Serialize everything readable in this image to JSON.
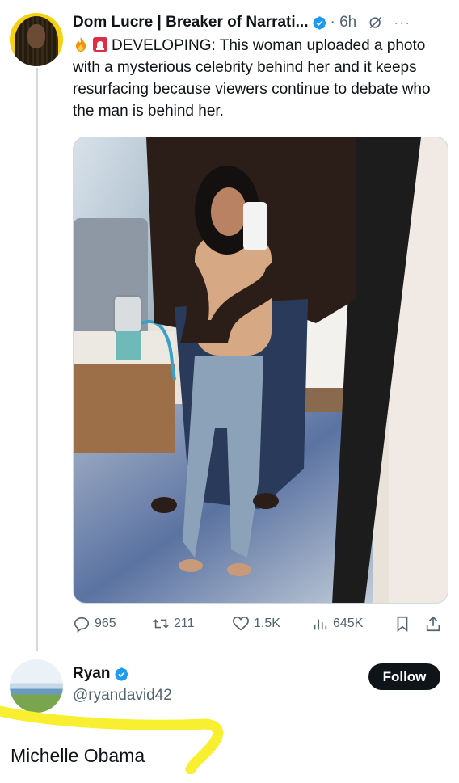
{
  "tweet": {
    "author_name": "Dom Lucre | Breaker of Narrati...",
    "time": "6h",
    "text": "DEVELOPING: This woman uploaded a photo with a mysterious celebrity behind her and it keeps resurfacing because viewers continue to debate who the man is behind her.",
    "stats": {
      "replies": "965",
      "reposts": "211",
      "likes": "1.5K",
      "views": "645K"
    }
  },
  "reply": {
    "name": "Ryan",
    "handle": "@ryandavid42",
    "follow_label": "Follow",
    "text": "Michelle Obama"
  },
  "colors": {
    "verified": "#1d9bf0",
    "muted_text": "#536471",
    "highlight": "#f7ef2f"
  }
}
